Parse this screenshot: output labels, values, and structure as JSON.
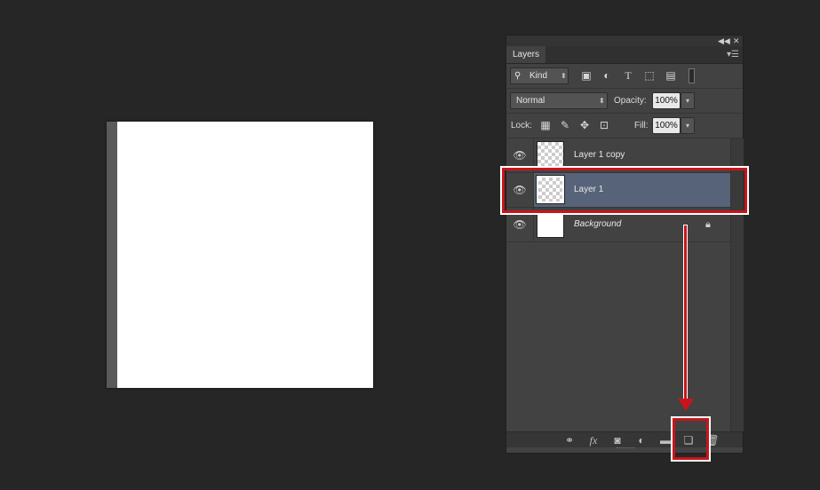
{
  "panel": {
    "collapse_icon": "double-chevron-left-icon",
    "close_icon": "close-icon",
    "tab_label": "Layers",
    "menu_icon": "panel-menu-icon"
  },
  "filter": {
    "kind_label": "Kind",
    "icons": [
      "search-icon",
      "image-filter-icon",
      "adjustment-filter-icon",
      "type-filter-icon",
      "shape-filter-icon",
      "smart-object-filter-icon",
      "filter-toggle-icon"
    ]
  },
  "blend": {
    "mode": "Normal",
    "opacity_label": "Opacity:",
    "opacity_value": "100%"
  },
  "lock": {
    "label": "Lock:",
    "fill_label": "Fill:",
    "fill_value": "100%"
  },
  "layers": [
    {
      "name": "Layer 1 copy",
      "selected": false
    },
    {
      "name": "Layer 1",
      "selected": true
    },
    {
      "name": "Background",
      "selected": false,
      "locked": true
    }
  ],
  "bottom_bar": {
    "icons": [
      "link-layers-icon",
      "fx-icon",
      "add-mask-icon",
      "adjustment-layer-icon",
      "group-folder-icon",
      "new-layer-icon",
      "trash-icon"
    ],
    "fx_label": "fx"
  },
  "colors": {
    "highlight": "#c8151b",
    "selected_layer": "#566378"
  }
}
